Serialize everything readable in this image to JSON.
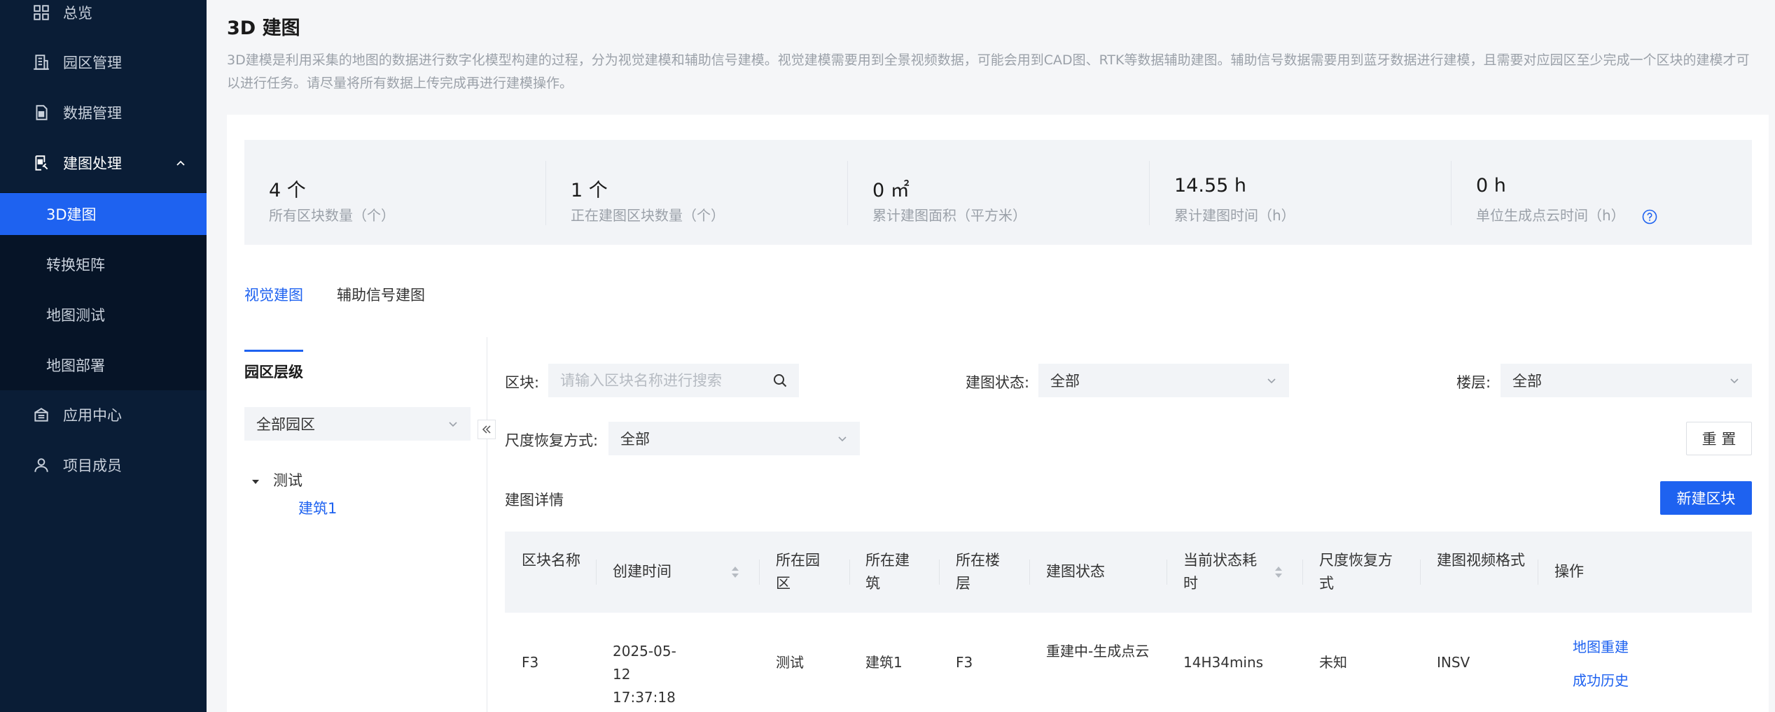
{
  "sidebar": {
    "items": [
      {
        "label": "总览",
        "icon": "grid-icon"
      },
      {
        "label": "园区管理",
        "icon": "building-icon"
      },
      {
        "label": "数据管理",
        "icon": "database-icon"
      },
      {
        "label": "建图处理",
        "icon": "map-process-icon"
      },
      {
        "label": "应用中心",
        "icon": "app-center-icon"
      },
      {
        "label": "项目成员",
        "icon": "user-icon"
      }
    ],
    "submenu": [
      {
        "label": "3D建图",
        "active": true
      },
      {
        "label": "转换矩阵"
      },
      {
        "label": "地图测试"
      },
      {
        "label": "地图部署"
      }
    ]
  },
  "header": {
    "title": "3D 建图",
    "description": "3D建模是利用采集的地图的数据进行数字化模型构建的过程，分为视觉建模和辅助信号建模。视觉建模需要用到全景视频数据，可能会用到CAD图、RTK等数据辅助建图。辅助信号数据需要用到蓝牙数据进行建模，且需要对应园区至少完成一个区块的建模才可以进行任务。请尽量将所有数据上传完成再进行建模操作。"
  },
  "stats": [
    {
      "value": "4 个",
      "label": "所有区块数量（个）"
    },
    {
      "value": "1 个",
      "label": "正在建图区块数量（个）"
    },
    {
      "value": "0 ㎡",
      "label": "累计建图面积（平方米）"
    },
    {
      "value": "14.55 h",
      "label": "累计建图时间（h）"
    },
    {
      "value": "0 h",
      "label": "单位生成点云时间（h）"
    }
  ],
  "tabs": [
    {
      "label": "视觉建图",
      "active": true
    },
    {
      "label": "辅助信号建图"
    }
  ],
  "tree": {
    "title": "园区层级",
    "selector": "全部园区",
    "root": "测试",
    "child": "建筑1"
  },
  "filters": {
    "block_label": "区块:",
    "block_placeholder": "请输入区块名称进行搜索",
    "status_label": "建图状态:",
    "status_value": "全部",
    "floor_label": "楼层:",
    "floor_value": "全部",
    "scale_label": "尺度恢复方式:",
    "scale_value": "全部",
    "reset_label": "重 置"
  },
  "section": {
    "title": "建图详情",
    "new_button": "新建区块"
  },
  "table": {
    "headers": [
      "区块名称",
      "创建时间",
      "所在园区",
      "所在建筑",
      "所在楼层",
      "建图状态",
      "当前状态耗时",
      "尺度恢复方式",
      "建图视频格式",
      "操作"
    ],
    "rows": [
      {
        "name": "F3",
        "created": "2025-05-12 17:37:18",
        "park": "测试",
        "building": "建筑1",
        "floor": "F3",
        "status": "重建中-生成点云",
        "elapsed": "14H34mins",
        "scale": "未知",
        "format": "INSV",
        "actions": [
          "地图重建",
          "成功历史"
        ]
      }
    ]
  },
  "colors": {
    "sidebar_bg": "#0a1d36",
    "accent": "#1e62f0",
    "muted_text": "#9ba1a9"
  }
}
